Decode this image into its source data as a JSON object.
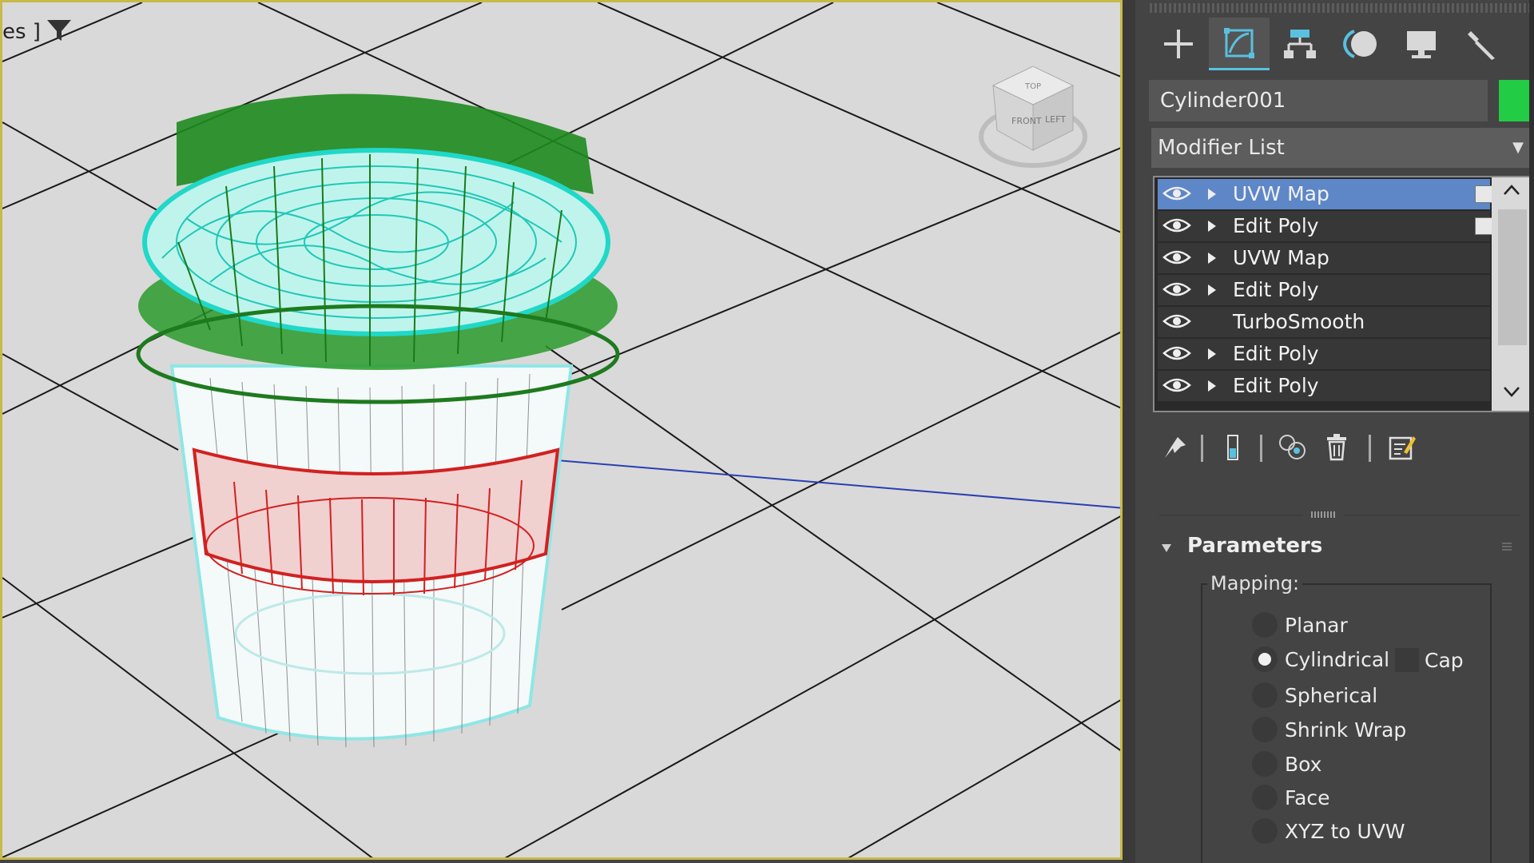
{
  "viewport": {
    "label": "es ]",
    "background": "#d9d9d9",
    "border_color": "#c8b94a",
    "viewcube_faces": [
      "TOP",
      "FRONT",
      "LEFT"
    ]
  },
  "command_panel": {
    "tabs": [
      {
        "name": "create-tab",
        "icon": "plus-icon",
        "active": false
      },
      {
        "name": "modify-tab",
        "icon": "modify-icon",
        "active": true
      },
      {
        "name": "hierarchy-tab",
        "icon": "hierarchy-icon",
        "active": false
      },
      {
        "name": "motion-tab",
        "icon": "motion-icon",
        "active": false
      },
      {
        "name": "display-tab",
        "icon": "display-icon",
        "active": false
      },
      {
        "name": "utilities-tab",
        "icon": "wrench-icon",
        "active": false
      }
    ],
    "object_name": "Cylinder001",
    "object_color": "#22cc44",
    "modifier_list_label": "Modifier List",
    "stack": [
      {
        "label": "UVW Map",
        "selected": true,
        "expandable": true,
        "box": true
      },
      {
        "label": "Edit Poly",
        "selected": false,
        "expandable": true,
        "box": true
      },
      {
        "label": "UVW Map",
        "selected": false,
        "expandable": true,
        "box": false
      },
      {
        "label": "Edit Poly",
        "selected": false,
        "expandable": true,
        "box": false
      },
      {
        "label": "TurboSmooth",
        "selected": false,
        "expandable": false,
        "box": false
      },
      {
        "label": "Edit Poly",
        "selected": false,
        "expandable": true,
        "box": false
      },
      {
        "label": "Edit Poly",
        "selected": false,
        "expandable": true,
        "box": false
      }
    ],
    "stack_tools": [
      "pin-stack-icon",
      "show-end-result-icon",
      "make-unique-icon",
      "remove-modifier-icon",
      "configure-modifier-sets-icon"
    ],
    "parameters": {
      "title": "Parameters",
      "mapping_label": "Mapping:",
      "options": [
        "Planar",
        "Cylindrical",
        "Spherical",
        "Shrink Wrap",
        "Box",
        "Face",
        "XYZ to UVW"
      ],
      "selected": "Cylindrical",
      "cap_label": "Cap",
      "cap_checked": false
    }
  }
}
